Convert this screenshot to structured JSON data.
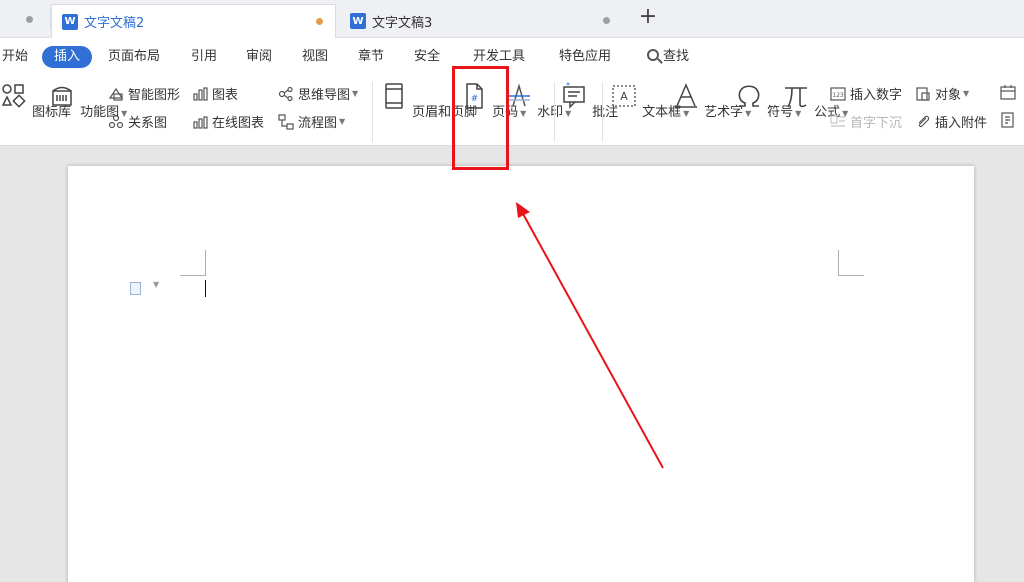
{
  "tabs": [
    {
      "title": "文字文稿2",
      "icon": "W",
      "active": true,
      "dot_color": "#e79a4b"
    },
    {
      "title": "文字文稿3",
      "icon": "W",
      "active": false,
      "dot_color": "#9aa0a8"
    }
  ],
  "new_tab_label": "+",
  "menu": {
    "items": [
      "开始",
      "插入",
      "页面布局",
      "引用",
      "审阅",
      "视图",
      "章节",
      "安全",
      "开发工具",
      "特色应用"
    ],
    "active": "插入",
    "search_label": "查找"
  },
  "ribbon": {
    "icon_library": "图标库",
    "function_map": "功能图",
    "smart_shape": "智能图形",
    "chart": "图表",
    "mind_map": "思维导图",
    "relation_map": "关系图",
    "online_chart": "在线图表",
    "flow_chart": "流程图",
    "header_footer": "页眉和页脚",
    "page_number": "页码",
    "watermark": "水印",
    "comment": "批注",
    "textbox": "文本框",
    "wordart": "艺术字",
    "symbol": "符号",
    "formula": "公式",
    "insert_number": "插入数字",
    "object": "对象",
    "drop_cap": "首字下沉",
    "insert_attachment": "插入附件"
  },
  "colors": {
    "accent": "#2f6fd6",
    "annotation": "#e8141a"
  }
}
